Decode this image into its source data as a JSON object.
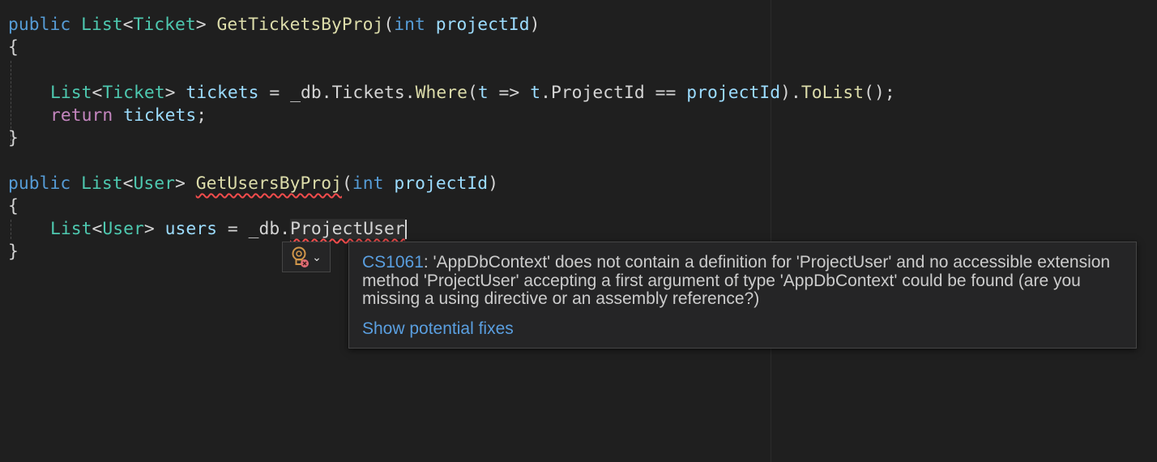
{
  "editor": {
    "method1": {
      "modifier": "public",
      "return_type_generic": "List",
      "return_type_arg": "Ticket",
      "name": "GetTicketsByProj",
      "param_type": "int",
      "param_name": "projectId",
      "open_brace": "{",
      "close_brace": "}",
      "body": {
        "decl_type_generic": "List",
        "decl_type_arg": "Ticket",
        "decl_var": "tickets",
        "assign": " = ",
        "db": "_db",
        "dot1": ".",
        "table": "Tickets",
        "dot2": ".",
        "where_fn": "Where",
        "lambda_open": "(",
        "lambda_param": "t",
        "arrow": " => ",
        "lambda_obj": "t",
        "dot3": ".",
        "member": "ProjectId",
        "eq": " == ",
        "compare_var": "projectId",
        "close_dot": ").",
        "tolist_fn": "ToList",
        "end": "();",
        "return_kw": "return",
        "return_var": "tickets",
        "semicolon": ";"
      }
    },
    "method2": {
      "modifier": "public",
      "return_type_generic": "List",
      "return_type_arg": "User",
      "name": "GetUsersByProj",
      "param_type": "int",
      "param_name": "projectId",
      "open_brace": "{",
      "close_brace": "}",
      "body": {
        "decl_type_generic": "List",
        "decl_type_arg": "User",
        "decl_var": "users",
        "assign": " = ",
        "db": "_db",
        "dot": ".",
        "member_error": "ProjectUser"
      }
    }
  },
  "lightbulb": {
    "icon": "lightbulb-error-icon",
    "dropdown_icon": "chevron-down-icon"
  },
  "hover": {
    "error_code": "CS1061",
    "message": ": 'AppDbContext' does not contain a definition for 'ProjectUser' and no accessible extension method 'ProjectUser' accepting a first argument of type 'AppDbContext' could be found (are you missing a using directive or an assembly reference?)",
    "fix_link": "Show potential fixes"
  },
  "colors": {
    "background": "#1f1f1f",
    "keyword": "#569cd6",
    "control_keyword": "#c586c0",
    "type": "#4ec9b0",
    "function": "#dcdcaa",
    "variable": "#9cdcfe",
    "error_squiggle": "#f14c4c",
    "link": "#5a9fe0"
  }
}
